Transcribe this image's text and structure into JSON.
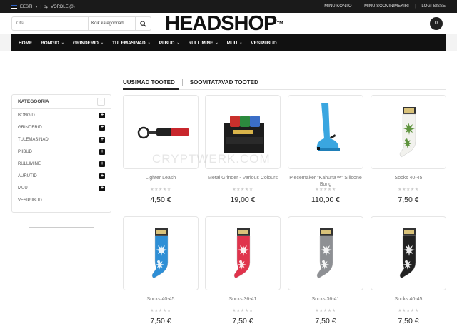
{
  "topbar": {
    "language": "EESTI",
    "compare": "VÕRDLE (0)",
    "links": [
      "MINU KONTO",
      "MINU SOOVINIMEKIRI",
      "LOGI SISSE"
    ]
  },
  "search": {
    "placeholder": "Otsi...",
    "category": "Kõik kategooriad"
  },
  "logo": {
    "text": "HEADSHOP",
    "mark": "™"
  },
  "cart": {
    "count": "0"
  },
  "nav": {
    "items": [
      {
        "label": "HOME",
        "dropdown": false
      },
      {
        "label": "BONGID",
        "dropdown": true
      },
      {
        "label": "GRINDERID",
        "dropdown": true
      },
      {
        "label": "TULEMASINAD",
        "dropdown": true
      },
      {
        "label": "PIIBUD",
        "dropdown": true
      },
      {
        "label": "RULLIMINE",
        "dropdown": true
      },
      {
        "label": "MUU",
        "dropdown": true
      },
      {
        "label": "VESIPIIBUD",
        "dropdown": false
      }
    ]
  },
  "sidebar": {
    "title": "KATEGOORIA",
    "items": [
      "BONGID",
      "GRINDERID",
      "TULEMASINAD",
      "PIIBUD",
      "RULLIMINE",
      "AURUTID",
      "MUU",
      "VESIPIIBUD"
    ]
  },
  "tabs": [
    "UUSIMAD TOOTED",
    "SOOVITATAVAD TOOTED"
  ],
  "watermark": "CRYPTWERK.COM",
  "products": [
    {
      "name": "Lighter Leash",
      "price": "4,50 €",
      "stars": "★★★★★"
    },
    {
      "name": "Metal Grinder - Various Colours",
      "price": "19,00 €",
      "stars": "★★★★★"
    },
    {
      "name": "Piecemaker \"Kahuna™\" Silicone Bong",
      "price": "110,00 €",
      "stars": "★★★★★"
    },
    {
      "name": "Socks 40-45",
      "price": "7,50 €",
      "stars": "★★★★★"
    },
    {
      "name": "Socks 40-45",
      "price": "7,50 €",
      "stars": "★★★★★"
    },
    {
      "name": "Socks 36-41",
      "price": "7,50 €",
      "stars": "★★★★★"
    },
    {
      "name": "Socks 36-41",
      "price": "7,50 €",
      "stars": "★★★★★"
    },
    {
      "name": "Socks 40-45",
      "price": "7,50 €",
      "stars": "★★★★★"
    }
  ],
  "colors": {
    "sock_white": "#f2f2ee",
    "sock_blue": "#2e8fd6",
    "sock_red": "#e0334c",
    "sock_grey": "#8e9094",
    "sock_black": "#222222",
    "bong_blue": "#3aa6e0",
    "leaf_green": "#4f8a2a"
  }
}
